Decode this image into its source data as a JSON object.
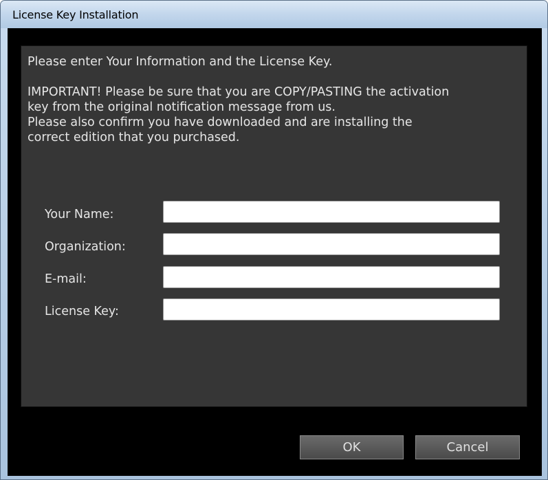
{
  "window": {
    "title": "License Key Installation"
  },
  "dialog": {
    "intro": "Please enter Your Information and the License Key.",
    "important_lines": [
      "IMPORTANT! Please be sure that you are COPY/PASTING the activation",
      "key from the original notification message from us.",
      "Please also confirm you have downloaded and are installing the",
      "correct edition that you purchased."
    ]
  },
  "form": {
    "fields": [
      {
        "label": "Your Name:",
        "value": ""
      },
      {
        "label": "Organization:",
        "value": ""
      },
      {
        "label": "E-mail:",
        "value": ""
      },
      {
        "label": "License Key:",
        "value": ""
      }
    ]
  },
  "buttons": {
    "ok_label": "OK",
    "cancel_label": "Cancel"
  },
  "colors": {
    "panel_bg": "#363636",
    "dialog_bg": "#000000",
    "text": "#e6e6e6"
  }
}
